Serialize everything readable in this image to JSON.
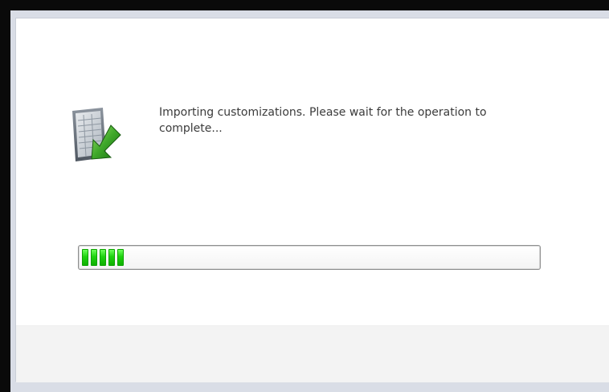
{
  "dialog": {
    "message": "Importing customizations. Please wait for the operation to complete...",
    "icon": "import-document-icon",
    "progress": {
      "percent": 10,
      "segments_visible": 5
    }
  },
  "colors": {
    "progress_green": "#1dd20f",
    "icon_arrow_green": "#2f9a1f",
    "footer_bg": "#f3f3f3",
    "outer_frame": "#0a0a0a"
  }
}
